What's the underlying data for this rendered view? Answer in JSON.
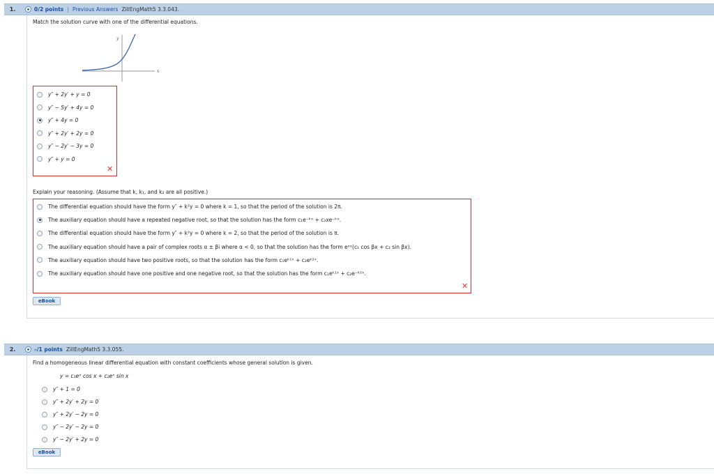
{
  "q1": {
    "num": "1.",
    "points": "0/2 points",
    "sep": "|",
    "prev": "Previous Answers",
    "code": "ZillEngMath5 3.3.043.",
    "prompt": "Match the solution curve with one of the differential equations.",
    "graph": {
      "ylabel": "y",
      "xlabel": "x"
    },
    "options": [
      "y″ + 2y′ + y = 0",
      "y″ − 5y′ + 4y = 0",
      "y″ + 4y = 0",
      "y″ + 2y′ + 2y = 0",
      "y″ − 2y′ − 3y = 0",
      "y″ + y = 0"
    ],
    "selected": 2,
    "explain_prompt": "Explain your reasoning. (Assume that k, k₁, and k₂ are all positive.)",
    "explain_options": [
      "The differential equation should have the form y″ + k²y = 0 where k = 1, so that the period of the solution is 2π.",
      "The auxiliary equation should have a repeated negative root, so that the solution has the form c₁e⁻ᵏˣ + c₂xe⁻ᵏˣ.",
      "The differential equation should have the form y″ + k²y = 0 where k = 2, so that the period of the solution is π.",
      "The auxiliary equation should have a pair of complex roots α ± βi where α < 0, so that the solution has the form eᵅˣ(c₁ cos βx + c₂ sin βx).",
      "The auxiliary equation should have two positive roots, so that the solution has the form c₁eᵏ¹ˣ + c₂eᵏ²ˣ.",
      "The auxiliary equation should have one positive and one negative root, so that the solution has the form c₁eᵏ¹ˣ + c₂e⁻ᵏ²ˣ."
    ],
    "explain_selected": 1,
    "ebook": "eBook"
  },
  "q2": {
    "num": "2.",
    "points": "–/1 points",
    "code": "ZillEngMath5 3.3.055.",
    "prompt": "Find a homogeneous linear differential equation with constant coefficients whose general solution is given.",
    "given": "y = c₁eˣ cos x + c₂eˣ sin x",
    "options": [
      "y″ + 1 = 0",
      "y″ + 2y′ + 2y = 0",
      "y″ + 2y′ − 2y = 0",
      "y″ − 2y′ − 2y = 0",
      "y″ − 2y′ + 2y = 0"
    ],
    "ebook": "eBook"
  },
  "colors": {
    "header_bg": "#bcd1e6",
    "link": "#1a4fa3",
    "wrong": "#d42a2a"
  },
  "icons": [
    "plus-circle-icon",
    "x-mark-icon",
    "radio-icon"
  ]
}
